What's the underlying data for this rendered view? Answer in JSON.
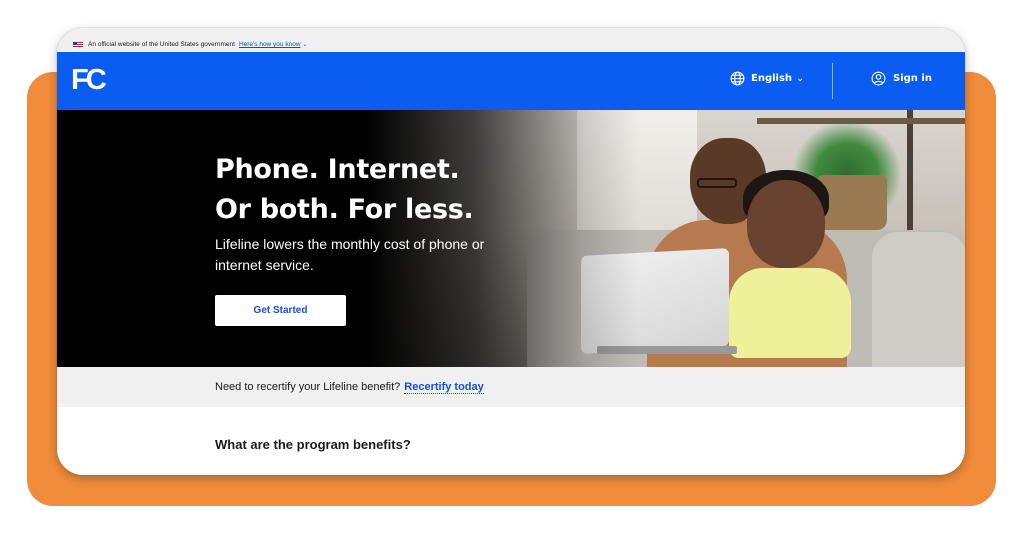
{
  "gov_banner": {
    "text": "An official website of the United States government",
    "link": "Here's how you know"
  },
  "header": {
    "logo": "FC",
    "language": "English",
    "sign_in": "Sign in",
    "color": "#0b5cf0"
  },
  "hero": {
    "title_line1": "Phone. Internet.",
    "title_line2": "Or both. For less.",
    "subtitle": "Lifeline lowers the monthly cost of phone or internet service.",
    "cta": "Get Started"
  },
  "recertify": {
    "text": "Need to recertify your Lifeline benefit?",
    "link": "Recertify today"
  },
  "benefits_heading": "What are the program benefits?",
  "colors": {
    "accent_orange": "#f08c3a",
    "link_blue": "#1a4ed8"
  }
}
